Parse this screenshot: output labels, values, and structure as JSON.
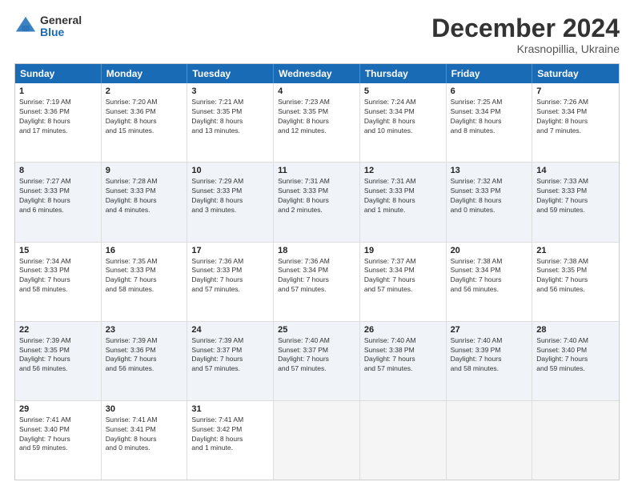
{
  "logo": {
    "general": "General",
    "blue": "Blue"
  },
  "title": "December 2024",
  "subtitle": "Krasnopillia, Ukraine",
  "days": [
    "Sunday",
    "Monday",
    "Tuesday",
    "Wednesday",
    "Thursday",
    "Friday",
    "Saturday"
  ],
  "rows": [
    [
      {
        "day": "1",
        "text": "Sunrise: 7:19 AM\nSunset: 3:36 PM\nDaylight: 8 hours\nand 17 minutes."
      },
      {
        "day": "2",
        "text": "Sunrise: 7:20 AM\nSunset: 3:36 PM\nDaylight: 8 hours\nand 15 minutes."
      },
      {
        "day": "3",
        "text": "Sunrise: 7:21 AM\nSunset: 3:35 PM\nDaylight: 8 hours\nand 13 minutes."
      },
      {
        "day": "4",
        "text": "Sunrise: 7:23 AM\nSunset: 3:35 PM\nDaylight: 8 hours\nand 12 minutes."
      },
      {
        "day": "5",
        "text": "Sunrise: 7:24 AM\nSunset: 3:34 PM\nDaylight: 8 hours\nand 10 minutes."
      },
      {
        "day": "6",
        "text": "Sunrise: 7:25 AM\nSunset: 3:34 PM\nDaylight: 8 hours\nand 8 minutes."
      },
      {
        "day": "7",
        "text": "Sunrise: 7:26 AM\nSunset: 3:34 PM\nDaylight: 8 hours\nand 7 minutes."
      }
    ],
    [
      {
        "day": "8",
        "text": "Sunrise: 7:27 AM\nSunset: 3:33 PM\nDaylight: 8 hours\nand 6 minutes."
      },
      {
        "day": "9",
        "text": "Sunrise: 7:28 AM\nSunset: 3:33 PM\nDaylight: 8 hours\nand 4 minutes."
      },
      {
        "day": "10",
        "text": "Sunrise: 7:29 AM\nSunset: 3:33 PM\nDaylight: 8 hours\nand 3 minutes."
      },
      {
        "day": "11",
        "text": "Sunrise: 7:31 AM\nSunset: 3:33 PM\nDaylight: 8 hours\nand 2 minutes."
      },
      {
        "day": "12",
        "text": "Sunrise: 7:31 AM\nSunset: 3:33 PM\nDaylight: 8 hours\nand 1 minute."
      },
      {
        "day": "13",
        "text": "Sunrise: 7:32 AM\nSunset: 3:33 PM\nDaylight: 8 hours\nand 0 minutes."
      },
      {
        "day": "14",
        "text": "Sunrise: 7:33 AM\nSunset: 3:33 PM\nDaylight: 7 hours\nand 59 minutes."
      }
    ],
    [
      {
        "day": "15",
        "text": "Sunrise: 7:34 AM\nSunset: 3:33 PM\nDaylight: 7 hours\nand 58 minutes."
      },
      {
        "day": "16",
        "text": "Sunrise: 7:35 AM\nSunset: 3:33 PM\nDaylight: 7 hours\nand 58 minutes."
      },
      {
        "day": "17",
        "text": "Sunrise: 7:36 AM\nSunset: 3:33 PM\nDaylight: 7 hours\nand 57 minutes."
      },
      {
        "day": "18",
        "text": "Sunrise: 7:36 AM\nSunset: 3:34 PM\nDaylight: 7 hours\nand 57 minutes."
      },
      {
        "day": "19",
        "text": "Sunrise: 7:37 AM\nSunset: 3:34 PM\nDaylight: 7 hours\nand 57 minutes."
      },
      {
        "day": "20",
        "text": "Sunrise: 7:38 AM\nSunset: 3:34 PM\nDaylight: 7 hours\nand 56 minutes."
      },
      {
        "day": "21",
        "text": "Sunrise: 7:38 AM\nSunset: 3:35 PM\nDaylight: 7 hours\nand 56 minutes."
      }
    ],
    [
      {
        "day": "22",
        "text": "Sunrise: 7:39 AM\nSunset: 3:35 PM\nDaylight: 7 hours\nand 56 minutes."
      },
      {
        "day": "23",
        "text": "Sunrise: 7:39 AM\nSunset: 3:36 PM\nDaylight: 7 hours\nand 56 minutes."
      },
      {
        "day": "24",
        "text": "Sunrise: 7:39 AM\nSunset: 3:37 PM\nDaylight: 7 hours\nand 57 minutes."
      },
      {
        "day": "25",
        "text": "Sunrise: 7:40 AM\nSunset: 3:37 PM\nDaylight: 7 hours\nand 57 minutes."
      },
      {
        "day": "26",
        "text": "Sunrise: 7:40 AM\nSunset: 3:38 PM\nDaylight: 7 hours\nand 57 minutes."
      },
      {
        "day": "27",
        "text": "Sunrise: 7:40 AM\nSunset: 3:39 PM\nDaylight: 7 hours\nand 58 minutes."
      },
      {
        "day": "28",
        "text": "Sunrise: 7:40 AM\nSunset: 3:40 PM\nDaylight: 7 hours\nand 59 minutes."
      }
    ],
    [
      {
        "day": "29",
        "text": "Sunrise: 7:41 AM\nSunset: 3:40 PM\nDaylight: 7 hours\nand 59 minutes."
      },
      {
        "day": "30",
        "text": "Sunrise: 7:41 AM\nSunset: 3:41 PM\nDaylight: 8 hours\nand 0 minutes."
      },
      {
        "day": "31",
        "text": "Sunrise: 7:41 AM\nSunset: 3:42 PM\nDaylight: 8 hours\nand 1 minute."
      },
      {
        "day": "",
        "text": ""
      },
      {
        "day": "",
        "text": ""
      },
      {
        "day": "",
        "text": ""
      },
      {
        "day": "",
        "text": ""
      }
    ]
  ]
}
